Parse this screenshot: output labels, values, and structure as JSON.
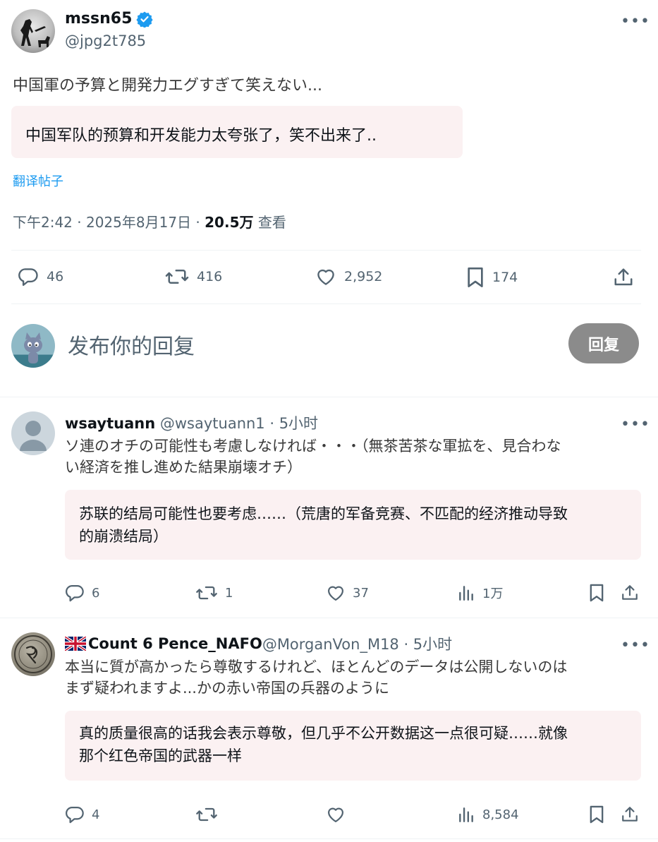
{
  "post": {
    "display_name": "mssn65",
    "handle": "@jpg2t785",
    "text": "中国軍の予算と開発力エグすぎて笑えない...",
    "translation": "中国军队的预算和开发能力太夸张了，笑不出来了..",
    "translate_link": "翻译帖子",
    "time": "下午2:42 · 2025年8月17日 · ",
    "views_count": "20.5万",
    "views_label": " 查看",
    "stats": {
      "replies": "46",
      "reposts": "416",
      "likes": "2,952",
      "bookmarks": "174"
    }
  },
  "composer": {
    "placeholder": "发布你的回复",
    "button": "回复"
  },
  "replies": [
    {
      "display_name": "wsaytuann",
      "meta": " @wsaytuann1 · 5小时",
      "text_line1": "ソ連のオチの可能性も考慮しなければ・・・（無茶苦茶な軍拡を、見合わな",
      "text_line2": "い経済を推し進めた結果崩壊オチ）",
      "translation_line1": "苏联的结局可能性也要考虑……（荒唐的军备竞赛、不匹配的经济推动导致",
      "translation_line2": "的崩溃结局）",
      "stats": {
        "replies": "6",
        "reposts": "1",
        "likes": "37",
        "views": "1万"
      }
    },
    {
      "display_name": "Count 6 Pence_NAFO",
      "meta": " @MorganVon_M18 · 5小时",
      "text_line1": "本当に質が高かったら尊敬するけれど、ほとんどのデータは公開しないのは",
      "text_line2": "まず疑われますよ...かの赤い帝国の兵器のように",
      "translation_line1": "真的质量很高的话我会表示尊敬，但几乎不公开数据这一点很可疑……就像",
      "translation_line2": "那个红色帝国的武器一样",
      "stats": {
        "replies": "4",
        "reposts": "",
        "likes": "",
        "views": "8,584"
      }
    }
  ],
  "colors": {
    "verified": "#1d9bf0",
    "link": "#1d9bf0",
    "muted": "#536471",
    "reply_button": "#8b8b8b"
  }
}
